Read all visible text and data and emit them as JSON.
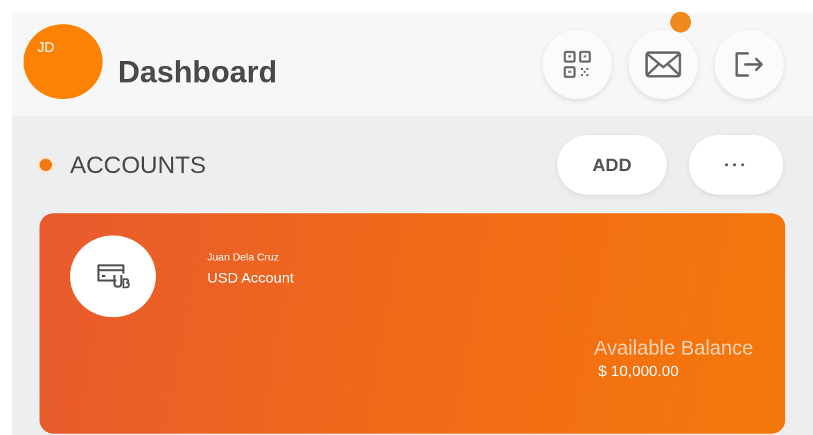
{
  "header": {
    "avatar_initials": "JD",
    "title": "Dashboard",
    "messages_badge": true
  },
  "accounts_section": {
    "title": "ACCOUNTS",
    "buttons": [
      "ADD",
      "···"
    ]
  },
  "account_card": {
    "holder": "Juan Dela Cruz",
    "account_name": "USD Account",
    "balance_label": "Available Balance",
    "balance": "$ 10,000.00"
  }
}
